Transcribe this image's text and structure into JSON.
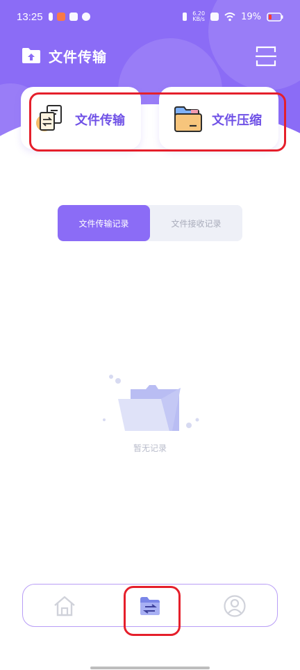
{
  "status_bar": {
    "time": "13:25",
    "net_speed_value": "6.20",
    "net_speed_unit": "KB/s",
    "battery": "19%"
  },
  "header": {
    "title": "文件传输"
  },
  "cards": {
    "transfer_label": "文件传输",
    "compress_label": "文件压缩"
  },
  "segmented": {
    "tabs": [
      {
        "label": "文件传输记录",
        "active": true
      },
      {
        "label": "文件接收记录",
        "active": false
      }
    ]
  },
  "empty_state": {
    "text": "暂无记录"
  },
  "colors": {
    "primary": "#8b6cf6",
    "card_text": "#6f51e6",
    "highlight": "#e51f2b"
  },
  "icons": {
    "header": "folder-upload-icon",
    "scan": "scan-icon",
    "card_transfer": "file-transfer-icon",
    "card_compress": "folder-compress-icon",
    "nav_home": "home-icon",
    "nav_transfer": "folder-transfer-icon",
    "nav_profile": "user-icon"
  }
}
